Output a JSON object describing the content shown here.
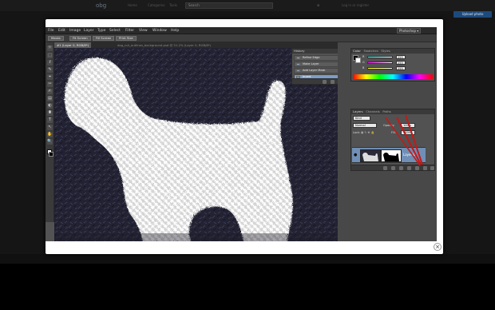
{
  "site": {
    "logo": "obg",
    "nav": [
      "Home",
      "Categories",
      "Tools"
    ],
    "search_placeholder": "Search",
    "top_right": "Log in or register",
    "button": "Upload photo"
  },
  "photoshop": {
    "menus": [
      "File",
      "Edit",
      "Image",
      "Layer",
      "Type",
      "Select",
      "Filter",
      "View",
      "Window",
      "Help"
    ],
    "options": [
      "Masks",
      "Fit Screen",
      "Fill Screen",
      "Print Size"
    ],
    "workspace": "Photoshop ▾",
    "doc_tab": "#1 (Layer 0, RGB/8*)",
    "doc_title": "dog_cut_outlines_background.psd @ 51.2% (Layer 0, RGB/8*)",
    "history": {
      "title": "History",
      "items": [
        "Refine Edge",
        "Make Layer",
        "Add Layer Mask",
        "Invert"
      ],
      "selected_index": 3
    },
    "color": {
      "tabs": [
        "Color",
        "Swatches",
        "Styles"
      ],
      "channels": [
        {
          "label": "R",
          "value": "255"
        },
        {
          "label": "G",
          "value": "255"
        },
        {
          "label": "B",
          "value": "255"
        }
      ]
    },
    "layers": {
      "tabs": [
        "Layers",
        "Channels",
        "Paths"
      ],
      "kind": "Kind",
      "blend_mode": "Normal",
      "opacity_label": "Opacity:",
      "opacity": "100%",
      "lock_label": "Lock:",
      "fill_label": "Fill:",
      "fill": "100%",
      "layer_name": "Layer 0"
    },
    "tools": [
      "⤧",
      "⬚",
      "ℓ",
      "✎",
      "⌖",
      "✂",
      "✍",
      "▤",
      "◐",
      "⬮",
      "T",
      "↖",
      "✋",
      "🔍"
    ],
    "annotation_color": "#c21a1a"
  }
}
